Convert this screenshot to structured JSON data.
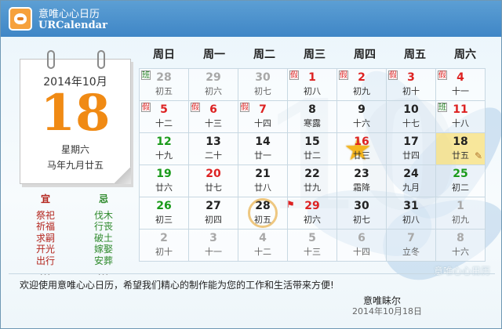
{
  "app": {
    "title_cn": "意唯心心日历",
    "title_en": "URCalendar"
  },
  "day_panel": {
    "year_month": "2014年10月",
    "day": "18",
    "weekday": "星期六",
    "lunar": "马年九月廿五"
  },
  "yiji": {
    "yi_label": "宜",
    "yi_items": [
      "祭祀",
      "祈福",
      "求嗣",
      "开光",
      "出行"
    ],
    "ji_label": "忌",
    "ji_items": [
      "伐木",
      "行丧",
      "破土",
      "嫁娶",
      "安葬"
    ],
    "more": "..."
  },
  "weekdays": [
    "周日",
    "周一",
    "周二",
    "周三",
    "周四",
    "周五",
    "周六"
  ],
  "calendar": {
    "rows": [
      [
        {
          "n": "28",
          "l": "初五",
          "cls": "other",
          "tag": "班"
        },
        {
          "n": "29",
          "l": "初六",
          "cls": "other"
        },
        {
          "n": "30",
          "l": "初七",
          "cls": "other"
        },
        {
          "n": "1",
          "l": "初八",
          "cls": "red",
          "tag": "假"
        },
        {
          "n": "2",
          "l": "初九",
          "cls": "red",
          "tag": "假"
        },
        {
          "n": "3",
          "l": "初十",
          "cls": "red",
          "tag": "假"
        },
        {
          "n": "4",
          "l": "十一",
          "cls": "red",
          "tag": "假"
        }
      ],
      [
        {
          "n": "5",
          "l": "十二",
          "cls": "red",
          "tag": "假"
        },
        {
          "n": "6",
          "l": "十三",
          "cls": "red",
          "tag": "假"
        },
        {
          "n": "7",
          "l": "十四",
          "cls": "red",
          "tag": "假"
        },
        {
          "n": "8",
          "l": "寒露",
          "cls": ""
        },
        {
          "n": "9",
          "l": "十六",
          "cls": ""
        },
        {
          "n": "10",
          "l": "十七",
          "cls": ""
        },
        {
          "n": "11",
          "l": "十八",
          "cls": "red",
          "tag": "班"
        }
      ],
      [
        {
          "n": "12",
          "l": "十九",
          "cls": "green"
        },
        {
          "n": "13",
          "l": "二十",
          "cls": ""
        },
        {
          "n": "14",
          "l": "廿一",
          "cls": ""
        },
        {
          "n": "15",
          "l": "廿二",
          "cls": ""
        },
        {
          "n": "16",
          "l": "廿三",
          "cls": "red starday"
        },
        {
          "n": "17",
          "l": "廿四",
          "cls": ""
        },
        {
          "n": "18",
          "l": "廿五",
          "cls": "today"
        }
      ],
      [
        {
          "n": "19",
          "l": "廿六",
          "cls": "green"
        },
        {
          "n": "20",
          "l": "廿七",
          "cls": "red"
        },
        {
          "n": "21",
          "l": "廿八",
          "cls": ""
        },
        {
          "n": "22",
          "l": "廿九",
          "cls": ""
        },
        {
          "n": "23",
          "l": "霜降",
          "cls": ""
        },
        {
          "n": "24",
          "l": "九月",
          "cls": ""
        },
        {
          "n": "25",
          "l": "初二",
          "cls": "green"
        }
      ],
      [
        {
          "n": "26",
          "l": "初三",
          "cls": "green"
        },
        {
          "n": "27",
          "l": "初四",
          "cls": ""
        },
        {
          "n": "28",
          "l": "初五",
          "cls": "circleday"
        },
        {
          "n": "29",
          "l": "初六",
          "cls": "red flagday"
        },
        {
          "n": "30",
          "l": "初七",
          "cls": ""
        },
        {
          "n": "31",
          "l": "初八",
          "cls": ""
        },
        {
          "n": "1",
          "l": "初九",
          "cls": "other"
        }
      ],
      [
        {
          "n": "2",
          "l": "初十",
          "cls": "other"
        },
        {
          "n": "3",
          "l": "十一",
          "cls": "other"
        },
        {
          "n": "4",
          "l": "十二",
          "cls": "other"
        },
        {
          "n": "5",
          "l": "十三",
          "cls": "other"
        },
        {
          "n": "6",
          "l": "十四",
          "cls": "other"
        },
        {
          "n": "7",
          "l": "立冬",
          "cls": "other"
        },
        {
          "n": "8",
          "l": "十六",
          "cls": "other"
        }
      ]
    ]
  },
  "watermark": "意唯心心日历",
  "footer": {
    "message": "欢迎使用意唯心心日历，希望我们精心的制作能为您的工作和生活带来方便!",
    "signature": "意唯眛尔",
    "date": "2014年10月18日"
  },
  "colors": {
    "accent_orange": "#f08a14",
    "title_blue": "#3f86c6",
    "holiday_red": "#d22222",
    "weekend_green": "#1a9a1a"
  }
}
